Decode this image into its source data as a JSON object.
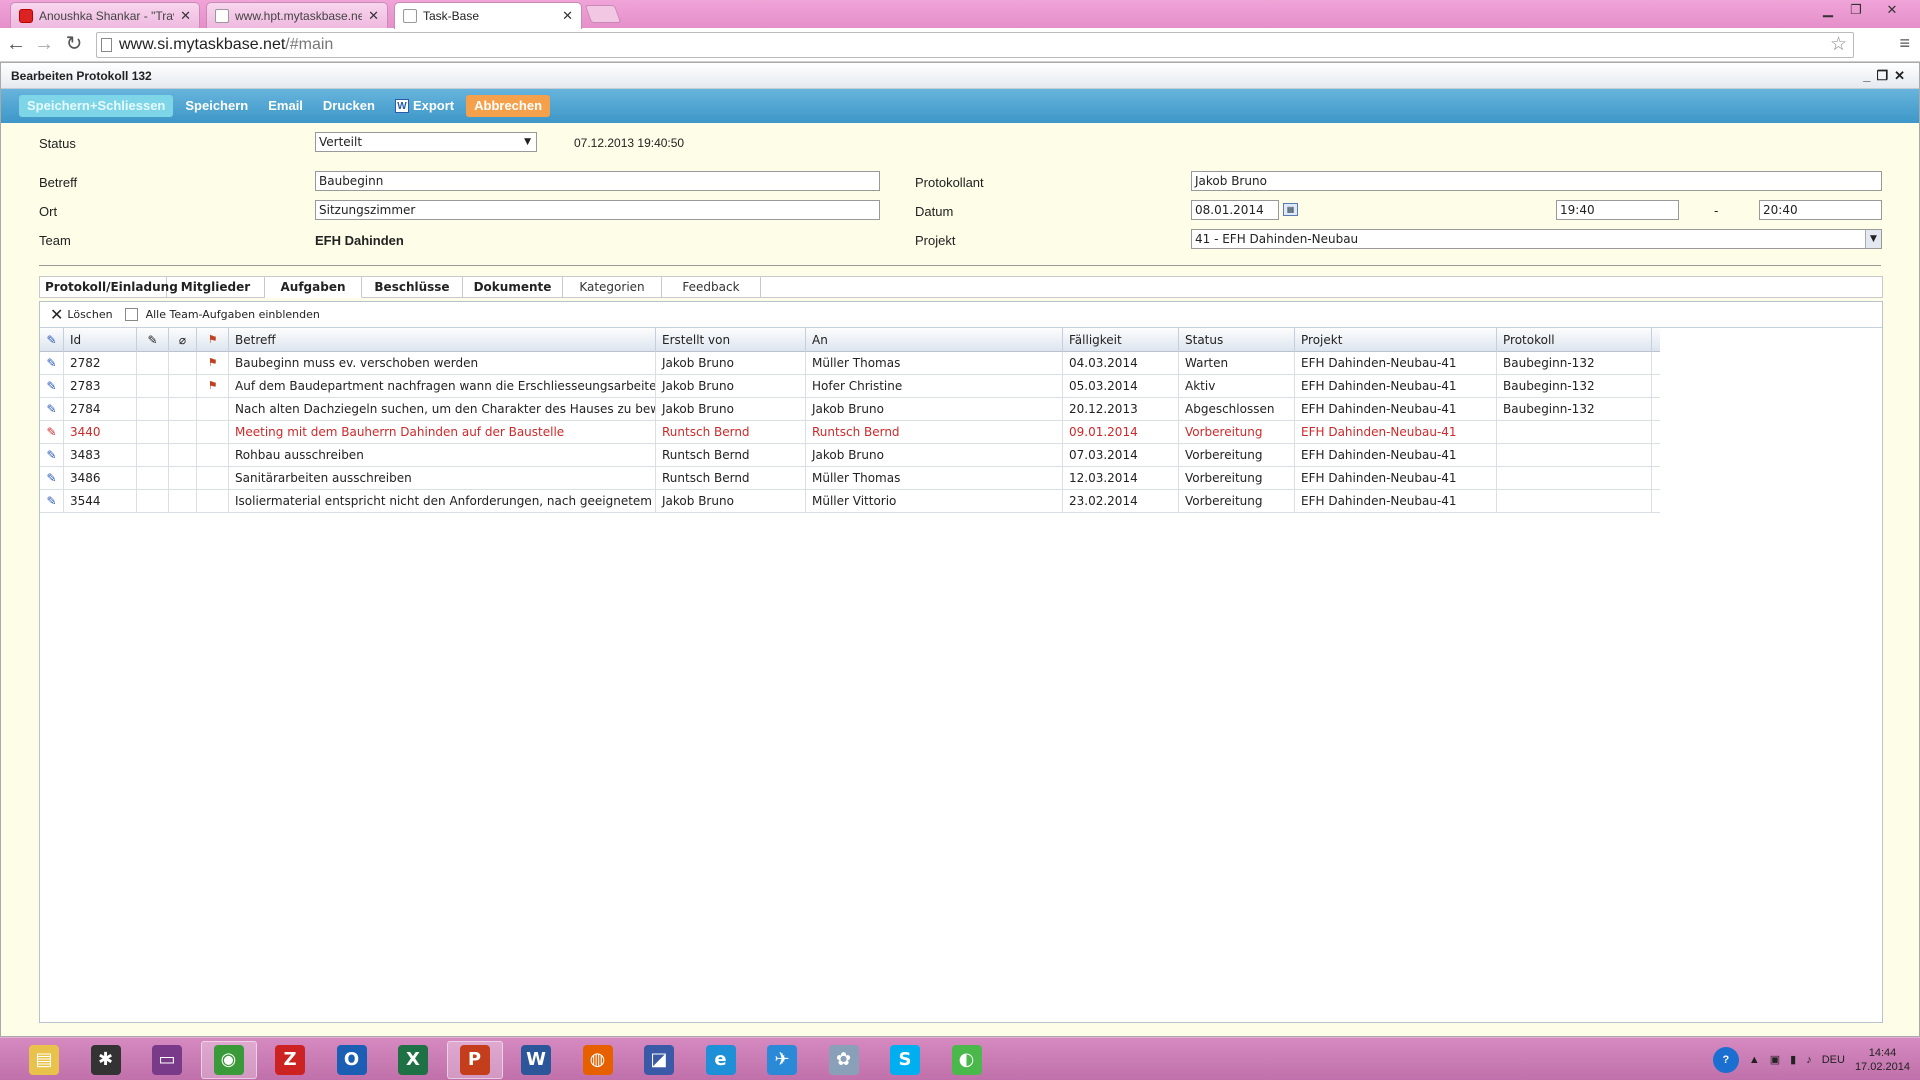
{
  "browser": {
    "tabs": [
      {
        "title": "Anoushka Shankar - \"Trav",
        "icon": "youtube-icon"
      },
      {
        "title": "www.hpt.mytaskbase.net/",
        "icon": "page-icon"
      },
      {
        "title": "Task-Base",
        "icon": "page-icon"
      }
    ],
    "active_tab": 2,
    "url_host": "www.si.mytaskbase.net",
    "url_path": "/#main"
  },
  "panel": {
    "title": "Bearbeiten Protokoll 132",
    "controls": [
      "_",
      "❐",
      "✕"
    ]
  },
  "toolbar": {
    "save_close": "Speichern+Schliessen",
    "save": "Speichern",
    "email": "Email",
    "print": "Drucken",
    "export": "Export",
    "cancel": "Abbrechen"
  },
  "form": {
    "status_label": "Status",
    "status_value": "Verteilt",
    "status_timestamp": "07.12.2013 19:40:50",
    "betreff_label": "Betreff",
    "betreff_value": "Baubeginn",
    "ort_label": "Ort",
    "ort_value": "Sitzungszimmer",
    "team_label": "Team",
    "team_value": "EFH Dahinden",
    "protokollant_label": "Protokollant",
    "protokollant_value": "Jakob Bruno",
    "datum_label": "Datum",
    "datum_value": "08.01.2014",
    "time_from": "19:40",
    "time_sep": "-",
    "time_to": "20:40",
    "projekt_label": "Projekt",
    "projekt_value": "41 - EFH Dahinden-Neubau"
  },
  "section_tabs": [
    {
      "label": "Protokoll/Einladung",
      "bold": true
    },
    {
      "label": "Mitglieder",
      "bold": true
    },
    {
      "label": "Aufgaben",
      "bold": true,
      "active": true
    },
    {
      "label": "Beschlüsse",
      "bold": true
    },
    {
      "label": "Dokumente",
      "bold": true
    },
    {
      "label": "Kategorien",
      "bold": false
    },
    {
      "label": "Feedback",
      "bold": false
    }
  ],
  "grid": {
    "delete_label": "Löschen",
    "show_all_label": "Alle Team-Aufgaben einblenden",
    "columns": [
      "Id",
      "Betreff",
      "Erstellt von",
      "An",
      "Fälligkeit",
      "Status",
      "Projekt",
      "Protokoll"
    ],
    "rows": [
      {
        "flag": true,
        "id": "2782",
        "betreff": "Baubeginn muss ev. verschoben werden",
        "erstellt": "Jakob Bruno",
        "an": "Müller Thomas",
        "faellig": "04.03.2014",
        "status": "Warten",
        "projekt": "EFH Dahinden-Neubau-41",
        "protokoll": "Baubeginn-132",
        "overdue": false
      },
      {
        "flag": true,
        "id": "2783",
        "betreff": "Auf dem Baudepartment nachfragen wann die Erschliesseungsarbeiten be",
        "erstellt": "Jakob Bruno",
        "an": "Hofer Christine",
        "faellig": "05.03.2014",
        "status": "Aktiv",
        "projekt": "EFH Dahinden-Neubau-41",
        "protokoll": "Baubeginn-132",
        "overdue": false
      },
      {
        "flag": false,
        "id": "2784",
        "betreff": "Nach alten Dachziegeln suchen, um den Charakter des Hauses zu bewahr",
        "erstellt": "Jakob Bruno",
        "an": "Jakob Bruno",
        "faellig": "20.12.2013",
        "status": "Abgeschlossen",
        "projekt": "EFH Dahinden-Neubau-41",
        "protokoll": "Baubeginn-132",
        "overdue": false
      },
      {
        "flag": false,
        "id": "3440",
        "betreff": "Meeting mit dem Bauherrn Dahinden auf der Baustelle",
        "erstellt": "Runtsch Bernd",
        "an": "Runtsch Bernd",
        "faellig": "09.01.2014",
        "status": "Vorbereitung",
        "projekt": "EFH Dahinden-Neubau-41",
        "protokoll": "",
        "overdue": true
      },
      {
        "flag": false,
        "id": "3483",
        "betreff": "Rohbau ausschreiben",
        "erstellt": "Runtsch Bernd",
        "an": "Jakob Bruno",
        "faellig": "07.03.2014",
        "status": "Vorbereitung",
        "projekt": "EFH Dahinden-Neubau-41",
        "protokoll": "",
        "overdue": false
      },
      {
        "flag": false,
        "id": "3486",
        "betreff": "Sanitärarbeiten ausschreiben",
        "erstellt": "Runtsch Bernd",
        "an": "Müller Thomas",
        "faellig": "12.03.2014",
        "status": "Vorbereitung",
        "projekt": "EFH Dahinden-Neubau-41",
        "protokoll": "",
        "overdue": false
      },
      {
        "flag": false,
        "id": "3544",
        "betreff": "Isoliermaterial entspricht nicht den Anforderungen, nach geeignetem Mate",
        "erstellt": "Jakob Bruno",
        "an": "Müller Vittorio",
        "faellig": "23.02.2014",
        "status": "Vorbereitung",
        "projekt": "EFH Dahinden-Neubau-41",
        "protokoll": "",
        "overdue": false
      }
    ],
    "overdue_color": "#cc2a2a"
  },
  "taskbar": {
    "apps": [
      {
        "name": "explorer-icon",
        "color": "#e8c24a"
      },
      {
        "name": "paint-app-icon",
        "color": "#333"
      },
      {
        "name": "presentation-app-icon",
        "color": "#7a3a8a"
      },
      {
        "name": "chrome-icon",
        "color": "#3a9a3a",
        "active": true
      },
      {
        "name": "filezilla-icon",
        "color": "#c22"
      },
      {
        "name": "outlook-icon",
        "color": "#1a5fb4"
      },
      {
        "name": "excel-icon",
        "color": "#1e7145"
      },
      {
        "name": "powerpoint-icon",
        "color": "#c43e1c",
        "active": true
      },
      {
        "name": "word-icon",
        "color": "#2b579a"
      },
      {
        "name": "firefox-icon",
        "color": "#e66000"
      },
      {
        "name": "network-app-icon",
        "color": "#3a5aa8"
      },
      {
        "name": "internet-explorer-icon",
        "color": "#1e90d8"
      },
      {
        "name": "app-icon",
        "color": "#2a8ad8"
      },
      {
        "name": "paint-palette-icon",
        "color": "#8aa0b8"
      },
      {
        "name": "skype-icon",
        "color": "#00aff0"
      },
      {
        "name": "app-green-icon",
        "color": "#4ab84a"
      }
    ],
    "language": "DEU",
    "time": "14:44",
    "date": "17.02.2014"
  }
}
